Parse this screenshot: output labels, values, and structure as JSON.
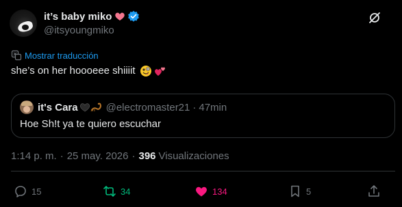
{
  "author": {
    "display_name": "it’s baby miko",
    "handle": "@itsyoungmiko",
    "name_emoji": "pink-heart",
    "verified": true
  },
  "translate": {
    "label": "Mostrar traducción"
  },
  "tweet": {
    "text": "she’s on her hoooeee shiiiit",
    "emojis": [
      "zany-face",
      "two-hearts"
    ]
  },
  "quote": {
    "display_name": "it's Cara",
    "handle": "@electromaster21",
    "separator": "·",
    "time": "47min",
    "text": "Hoe Sh!t ya te quiero escuchar",
    "name_emojis": [
      "black-heart",
      "scorpion"
    ]
  },
  "meta": {
    "time": "1:14 p. m.",
    "separator": "·",
    "date": "25 may. 2026",
    "views_count": "396",
    "views_label": "Visualizaciones"
  },
  "actions": {
    "replies": "15",
    "retweets": "34",
    "likes": "134",
    "bookmarks": "5"
  },
  "colors": {
    "background": "#000000",
    "text": "#e7e9ea",
    "muted": "#71767b",
    "link": "#1d9bf0",
    "retweet": "#00ba7c",
    "like": "#f91880",
    "border": "#2f3336"
  }
}
